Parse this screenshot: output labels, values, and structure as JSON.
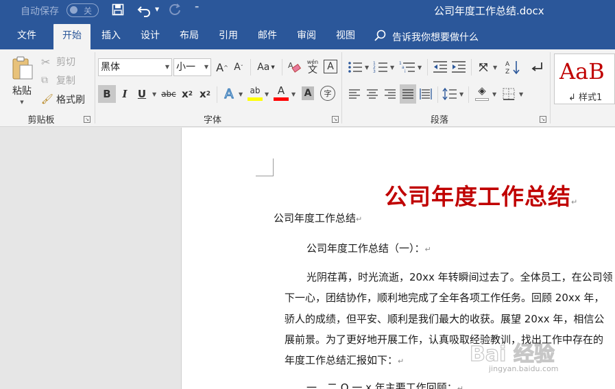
{
  "titlebar": {
    "autosave_label": "自动保存",
    "autosave_state": "关",
    "doc_title": "公司年度工作总结.docx",
    "save_icon": "save-icon",
    "undo_icon": "undo-icon",
    "redo_icon": "redo-icon",
    "customize_icon": "customize-qat-icon"
  },
  "tabs": [
    {
      "label": "文件"
    },
    {
      "label": "开始",
      "active": true
    },
    {
      "label": "插入"
    },
    {
      "label": "设计"
    },
    {
      "label": "布局"
    },
    {
      "label": "引用"
    },
    {
      "label": "邮件"
    },
    {
      "label": "审阅"
    },
    {
      "label": "视图"
    }
  ],
  "tell_me": "告诉我你想要做什么",
  "clipboard": {
    "paste": "粘贴",
    "cut": "剪切",
    "copy": "复制",
    "format_painter": "格式刷",
    "group": "剪贴板"
  },
  "font": {
    "name": "黑体",
    "size": "小一",
    "group": "字体",
    "grow": "A",
    "shrink": "A",
    "change_case": "Aa",
    "phonetic_top": "wén",
    "phonetic_bottom": "文",
    "char_border": "A",
    "bold": "B",
    "italic": "I",
    "underline": "U",
    "strike": "abc",
    "subscript_base": "x",
    "subscript_mark": "2",
    "superscript_base": "x",
    "superscript_mark": "2",
    "effects": "A",
    "highlight": "ab",
    "font_color": "A",
    "shading": "A",
    "enclose": "字"
  },
  "paragraph": {
    "group": "段落"
  },
  "styles": {
    "preview": "AaB",
    "name": "样式1"
  },
  "colors": {
    "brand": "#2b579a",
    "title_red": "#c00000",
    "highlight_yellow": "#ffff00",
    "font_red": "#ff0000"
  },
  "document": {
    "title": "公司年度工作总结",
    "line1": "公司年度工作总结",
    "line2": "公司年度工作总结（一）：",
    "para": [
      "光阴荏苒，时光流逝，20xx 年转瞬间过去了。全体员工，在公司领",
      "下一心，团结协作，顺利地完成了全年各项工作任务。回顾 20xx 年，",
      "骄人的成绩，但平安、顺利是我们最大的收获。展望 20xx 年，相信公",
      "展前景。为了更好地开展工作，认真吸取经验教训，找出工作中存在的",
      "年度工作总结汇报如下："
    ],
    "line_last": "一、二 O 一 x 年主要工作回顾：",
    "para_mark": "↵"
  },
  "watermark": {
    "brand": "Bai 经验",
    "url": "jingyan.baidu.com"
  }
}
